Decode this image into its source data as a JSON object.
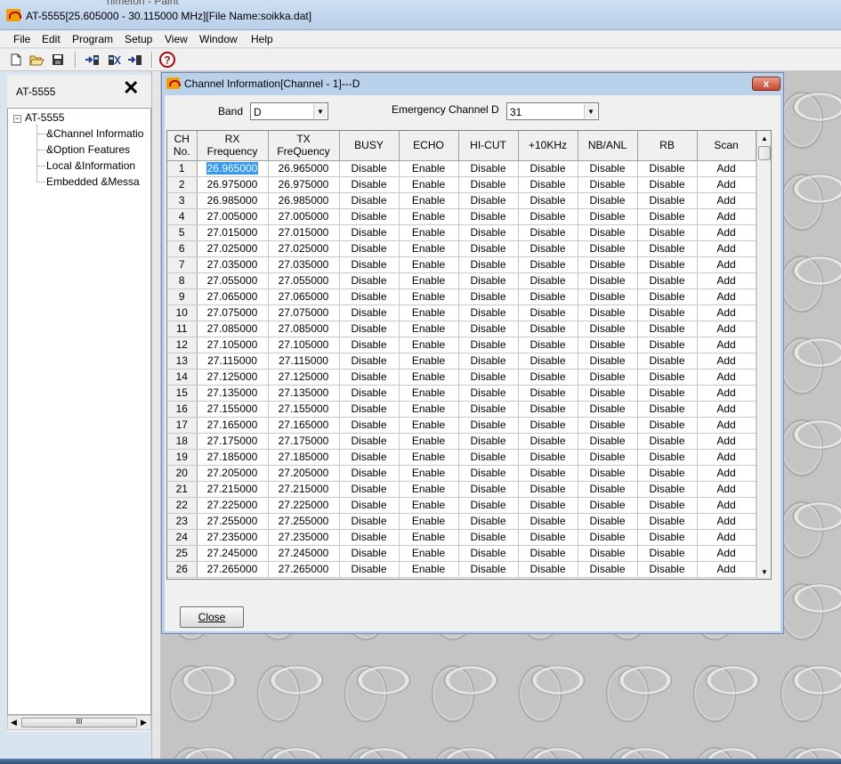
{
  "app": {
    "title": "AT-5555[25.605000 - 30.115000 MHz][File Name:soikka.dat]",
    "background_title": "nimeton - Paint"
  },
  "menu": [
    "File",
    "Edit",
    "Program",
    "Setup",
    "View",
    "Window",
    "Help"
  ],
  "toolbar": {
    "icons": [
      "new-file-icon",
      "open-folder-icon",
      "save-disk-icon",
      "read-radio-icon",
      "write-radio-icon",
      "transfer-radio-icon",
      "help-icon"
    ]
  },
  "left_panel": {
    "title": "AT-5555",
    "close_glyph": "✕",
    "tree": {
      "root_toggle": "−",
      "root": "AT-5555",
      "children": [
        "&Channel Informatio",
        "&Option Features",
        "Local &Information",
        "Embedded &Messa"
      ]
    },
    "hscroll_grip": "III"
  },
  "dialog": {
    "title": "Channel Information[Channel - 1]---D",
    "close_glyph": "x",
    "band_label": "Band",
    "band_value": "D",
    "emergency_label": "Emergency Channel D",
    "emergency_value": "31",
    "close_button": "Close",
    "columns": [
      "CH\nNo.",
      "RX\nFrequency",
      "TX\nFreQuency",
      "BUSY",
      "ECHO",
      "HI-CUT",
      "+10KHz",
      "NB/ANL",
      "RB",
      "Scan"
    ],
    "rows": [
      [
        "1",
        "26.965000",
        "26.965000",
        "Disable",
        "Enable",
        "Disable",
        "Disable",
        "Disable",
        "Disable",
        "Add"
      ],
      [
        "2",
        "26.975000",
        "26.975000",
        "Disable",
        "Enable",
        "Disable",
        "Disable",
        "Disable",
        "Disable",
        "Add"
      ],
      [
        "3",
        "26.985000",
        "26.985000",
        "Disable",
        "Enable",
        "Disable",
        "Disable",
        "Disable",
        "Disable",
        "Add"
      ],
      [
        "4",
        "27.005000",
        "27.005000",
        "Disable",
        "Enable",
        "Disable",
        "Disable",
        "Disable",
        "Disable",
        "Add"
      ],
      [
        "5",
        "27.015000",
        "27.015000",
        "Disable",
        "Enable",
        "Disable",
        "Disable",
        "Disable",
        "Disable",
        "Add"
      ],
      [
        "6",
        "27.025000",
        "27.025000",
        "Disable",
        "Enable",
        "Disable",
        "Disable",
        "Disable",
        "Disable",
        "Add"
      ],
      [
        "7",
        "27.035000",
        "27.035000",
        "Disable",
        "Enable",
        "Disable",
        "Disable",
        "Disable",
        "Disable",
        "Add"
      ],
      [
        "8",
        "27.055000",
        "27.055000",
        "Disable",
        "Enable",
        "Disable",
        "Disable",
        "Disable",
        "Disable",
        "Add"
      ],
      [
        "9",
        "27.065000",
        "27.065000",
        "Disable",
        "Enable",
        "Disable",
        "Disable",
        "Disable",
        "Disable",
        "Add"
      ],
      [
        "10",
        "27.075000",
        "27.075000",
        "Disable",
        "Enable",
        "Disable",
        "Disable",
        "Disable",
        "Disable",
        "Add"
      ],
      [
        "11",
        "27.085000",
        "27.085000",
        "Disable",
        "Enable",
        "Disable",
        "Disable",
        "Disable",
        "Disable",
        "Add"
      ],
      [
        "12",
        "27.105000",
        "27.105000",
        "Disable",
        "Enable",
        "Disable",
        "Disable",
        "Disable",
        "Disable",
        "Add"
      ],
      [
        "13",
        "27.115000",
        "27.115000",
        "Disable",
        "Enable",
        "Disable",
        "Disable",
        "Disable",
        "Disable",
        "Add"
      ],
      [
        "14",
        "27.125000",
        "27.125000",
        "Disable",
        "Enable",
        "Disable",
        "Disable",
        "Disable",
        "Disable",
        "Add"
      ],
      [
        "15",
        "27.135000",
        "27.135000",
        "Disable",
        "Enable",
        "Disable",
        "Disable",
        "Disable",
        "Disable",
        "Add"
      ],
      [
        "16",
        "27.155000",
        "27.155000",
        "Disable",
        "Enable",
        "Disable",
        "Disable",
        "Disable",
        "Disable",
        "Add"
      ],
      [
        "17",
        "27.165000",
        "27.165000",
        "Disable",
        "Enable",
        "Disable",
        "Disable",
        "Disable",
        "Disable",
        "Add"
      ],
      [
        "18",
        "27.175000",
        "27.175000",
        "Disable",
        "Enable",
        "Disable",
        "Disable",
        "Disable",
        "Disable",
        "Add"
      ],
      [
        "19",
        "27.185000",
        "27.185000",
        "Disable",
        "Enable",
        "Disable",
        "Disable",
        "Disable",
        "Disable",
        "Add"
      ],
      [
        "20",
        "27.205000",
        "27.205000",
        "Disable",
        "Enable",
        "Disable",
        "Disable",
        "Disable",
        "Disable",
        "Add"
      ],
      [
        "21",
        "27.215000",
        "27.215000",
        "Disable",
        "Enable",
        "Disable",
        "Disable",
        "Disable",
        "Disable",
        "Add"
      ],
      [
        "22",
        "27.225000",
        "27.225000",
        "Disable",
        "Enable",
        "Disable",
        "Disable",
        "Disable",
        "Disable",
        "Add"
      ],
      [
        "23",
        "27.255000",
        "27.255000",
        "Disable",
        "Enable",
        "Disable",
        "Disable",
        "Disable",
        "Disable",
        "Add"
      ],
      [
        "24",
        "27.235000",
        "27.235000",
        "Disable",
        "Enable",
        "Disable",
        "Disable",
        "Disable",
        "Disable",
        "Add"
      ],
      [
        "25",
        "27.245000",
        "27.245000",
        "Disable",
        "Enable",
        "Disable",
        "Disable",
        "Disable",
        "Disable",
        "Add"
      ],
      [
        "26",
        "27.265000",
        "27.265000",
        "Disable",
        "Enable",
        "Disable",
        "Disable",
        "Disable",
        "Disable",
        "Add"
      ]
    ],
    "selected_cell": "26.965000"
  },
  "colors": {
    "selection": "#3399ff",
    "dialog_frame": "#b9d1ea",
    "close_red": "#c9432c",
    "workspace": "#c4c4c4"
  }
}
